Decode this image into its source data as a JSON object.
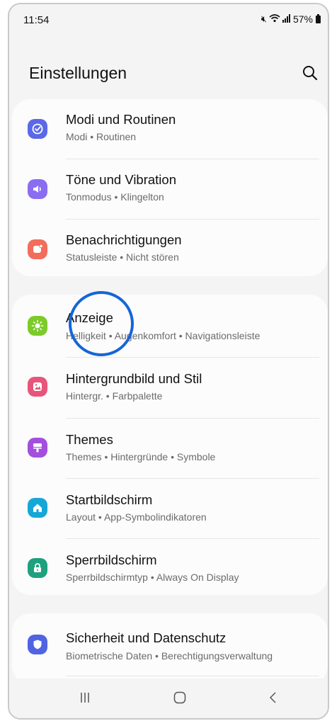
{
  "status_bar": {
    "time": "11:54",
    "battery_percent": "57%",
    "icons": [
      "mute-icon",
      "wifi-icon",
      "signal-icon",
      "battery-icon"
    ]
  },
  "header": {
    "title": "Einstellungen",
    "search_icon": "search-icon"
  },
  "groups": [
    {
      "items": [
        {
          "label": "Modi und Routinen",
          "sub": "Modi • Routinen",
          "icon": "modes-icon",
          "color": "#5b68e8"
        },
        {
          "label": "Töne und Vibration",
          "sub": "Tonmodus • Klingelton",
          "icon": "sound-icon",
          "color": "#8a6df0"
        },
        {
          "label": "Benachrichtigungen",
          "sub": "Statusleiste • Nicht stören",
          "icon": "notifications-icon",
          "color": "#f26d5b"
        }
      ]
    },
    {
      "items": [
        {
          "label": "Anzeige",
          "sub": "Helligkeit • Augenkomfort • Navigationsleiste",
          "icon": "display-icon",
          "color": "#7ccb2a"
        },
        {
          "label": "Hintergrundbild und Stil",
          "sub": "Hintergr. • Farbpalette",
          "icon": "wallpaper-icon",
          "color": "#e8557a"
        },
        {
          "label": "Themes",
          "sub": "Themes • Hintergründe • Symbole",
          "icon": "themes-icon",
          "color": "#a34fde"
        },
        {
          "label": "Startbildschirm",
          "sub": "Layout • App-Symbolindikatoren",
          "icon": "home-icon",
          "color": "#17a7d7"
        },
        {
          "label": "Sperrbildschirm",
          "sub": "Sperrbildschirmtyp • Always On Display",
          "icon": "lock-icon",
          "color": "#1fa07e"
        }
      ]
    },
    {
      "items": [
        {
          "label": "Sicherheit und Datenschutz",
          "sub": "Biometrische Daten • Berechtigungsverwaltung",
          "icon": "shield-icon",
          "color": "#4f63e3"
        }
      ]
    }
  ],
  "annotation": {
    "highlight": "circle around Anzeige",
    "color": "#1565d8"
  },
  "nav_bar": {
    "icons": [
      "recents-icon",
      "home-button-icon",
      "back-icon"
    ]
  }
}
